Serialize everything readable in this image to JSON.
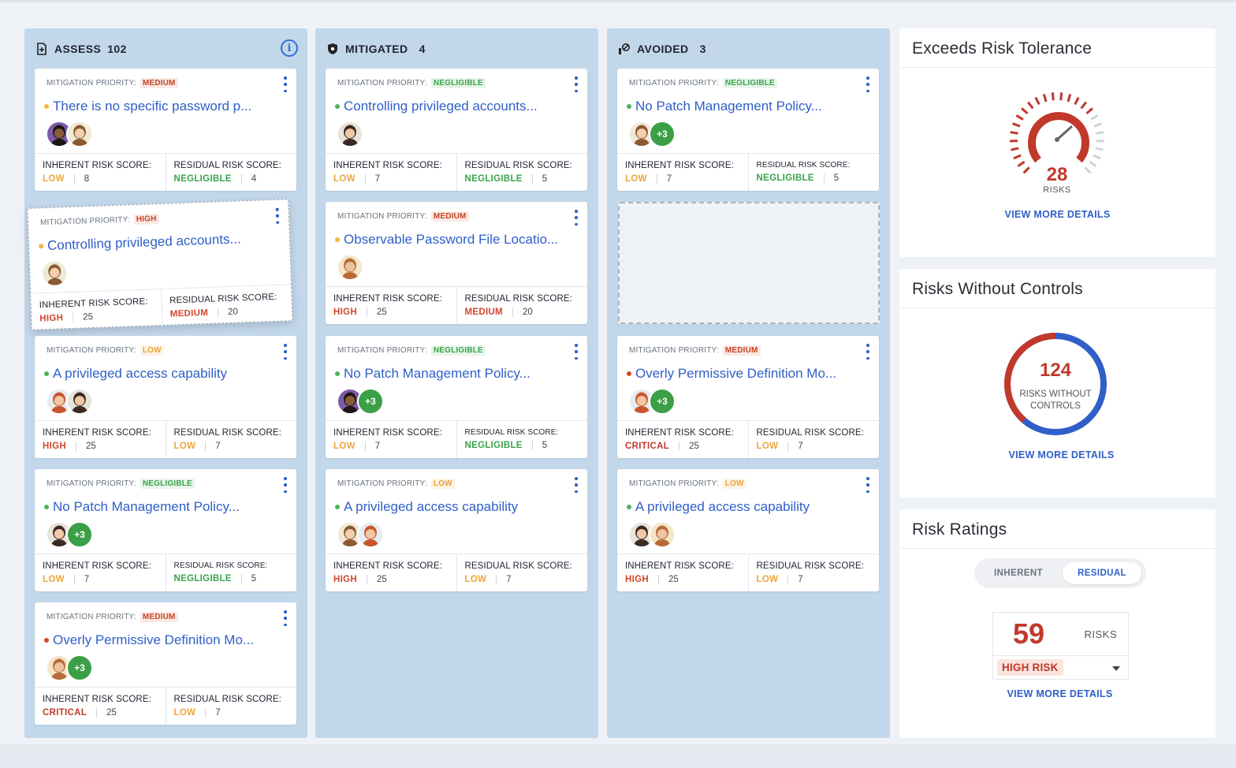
{
  "columns": [
    {
      "title": "ASSESS",
      "count": "102",
      "icon": "document-plus-icon"
    },
    {
      "title": "MITIGATED",
      "count": "4",
      "icon": "shield-icon"
    },
    {
      "title": "AVOIDED",
      "count": "3",
      "icon": "avoid-icon"
    }
  ],
  "labels": {
    "mitigation_priority": "MITIGATION PRIORITY:",
    "inherent": "INHERENT RISK SCORE:",
    "residual": "RESIDUAL RISK SCORE:"
  },
  "assess_cards": [
    {
      "priority": "MEDIUM",
      "title": "There is no specific password p...",
      "inh_level": "LOW",
      "inh_score": "8",
      "res_level": "NEGLIGIBLE",
      "res_score": "4"
    },
    {
      "priority": "HIGH",
      "title": "Controlling privileged accounts...",
      "inh_level": "HIGH",
      "inh_score": "25",
      "res_level": "MEDIUM",
      "res_score": "20"
    },
    {
      "priority": "LOW",
      "title": "A privileged access capability",
      "inh_level": "HIGH",
      "inh_score": "25",
      "res_level": "LOW",
      "res_score": "7"
    },
    {
      "priority": "NEGLIGIBLE",
      "title": "No Patch Management Policy...",
      "inh_level": "LOW",
      "inh_score": "7",
      "res_level": "NEGLIGIBLE",
      "res_score": "5",
      "more": "+3"
    },
    {
      "priority": "MEDIUM",
      "title": "Overly Permissive Definition Mo...",
      "inh_level": "CRITICAL",
      "inh_score": "25",
      "res_level": "LOW",
      "res_score": "7",
      "more": "+3"
    }
  ],
  "mitigated_cards": [
    {
      "priority": "NEGLIGIBLE",
      "title": "Controlling privileged accounts...",
      "inh_level": "LOW",
      "inh_score": "7",
      "res_level": "NEGLIGIBLE",
      "res_score": "5"
    },
    {
      "priority": "MEDIUM",
      "title": "Observable Password File Locatio...",
      "inh_level": "HIGH",
      "inh_score": "25",
      "res_level": "MEDIUM",
      "res_score": "20"
    },
    {
      "priority": "NEGLIGIBLE",
      "title": "No Patch Management Policy...",
      "inh_level": "LOW",
      "inh_score": "7",
      "res_level": "NEGLIGIBLE",
      "res_score": "5",
      "more": "+3"
    },
    {
      "priority": "LOW",
      "title": "A privileged access capability",
      "inh_level": "HIGH",
      "inh_score": "25",
      "res_level": "LOW",
      "res_score": "7"
    }
  ],
  "avoided_cards": [
    {
      "priority": "NEGLIGIBLE",
      "title": "No Patch Management Policy...",
      "inh_level": "LOW",
      "inh_score": "7",
      "res_level": "NEGLIGIBLE",
      "res_score": "5",
      "more": "+3"
    },
    {
      "priority": "MEDIUM",
      "title": "Overly Permissive Definition Mo...",
      "inh_level": "CRITICAL",
      "inh_score": "25",
      "res_level": "LOW",
      "res_score": "7",
      "more": "+3"
    },
    {
      "priority": "LOW",
      "title": "A privileged access capability",
      "inh_level": "HIGH",
      "inh_score": "25",
      "res_level": "LOW",
      "res_score": "7"
    }
  ],
  "panels": {
    "tolerance": {
      "title": "Exceeds Risk Tolerance",
      "value": "28",
      "unit": "RISKS",
      "link": "VIEW MORE DETAILS"
    },
    "controls": {
      "title": "Risks Without Controls",
      "value": "124",
      "line1": "RISKS WITHOUT",
      "line2": "CONTROLS",
      "link": "VIEW MORE DETAILS"
    },
    "ratings": {
      "title": "Risk Ratings",
      "tab_inherent": "INHERENT",
      "tab_residual": "RESIDUAL",
      "value": "59",
      "unit": "RISKS",
      "selected": "HIGH RISK",
      "link": "VIEW MORE DETAILS"
    }
  },
  "colors": {
    "accent": "#2f5fc8",
    "column_bg": "#c2d7ea",
    "danger": "#c0392b",
    "success": "#3aa34c",
    "warning": "#eba63a"
  }
}
